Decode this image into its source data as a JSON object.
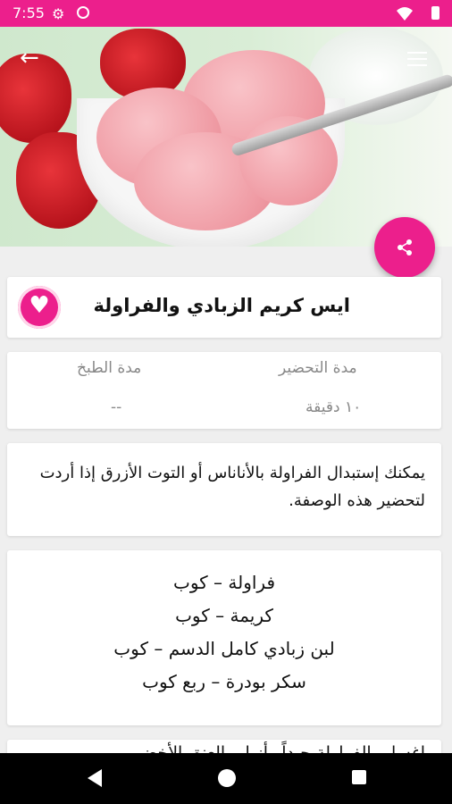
{
  "status_bar": {
    "time": "7:55",
    "icons": [
      "gear-icon",
      "dnd-icon",
      "wifi-icon",
      "battery-icon"
    ]
  },
  "theme": {
    "accent": "#ec1f8c"
  },
  "toolbar": {
    "back_icon": "arrow-left-icon",
    "menu_icon": "hamburger-menu-icon",
    "share_icon": "share-icon"
  },
  "recipe": {
    "title": "ايس كريم الزبادي والفراولة",
    "favorite_icon": "heart-icon",
    "prep_label": "مدة التحضير",
    "prep_value": "١٠ دقيقة",
    "cook_label": "مدة الطبخ",
    "cook_value": "--",
    "note": "يمكنك إستبدال الفراولة بالأناناس أو التوت الأزرق إذا أردت لتحضير هذه الوصفة.",
    "ingredients": [
      "فراولة – كوب",
      "كريمة – كوب",
      "لبن زبادي كامل الدسم – كوب",
      "سكر بودرة – ربع كوب"
    ],
    "next_step_partial": "اغسلي الفراولة جيداً وأزيلي العنق الأخضر"
  }
}
